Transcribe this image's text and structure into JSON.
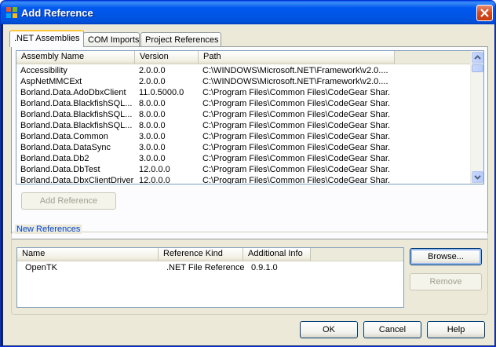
{
  "window": {
    "title": "Add Reference",
    "icons": {
      "app": "app-icon",
      "close": "close-icon"
    }
  },
  "tabs": [
    {
      "label": ".NET Assemblies",
      "active": true
    },
    {
      "label": "COM Imports",
      "active": false
    },
    {
      "label": "Project References",
      "active": false
    }
  ],
  "assemblies": {
    "columns": [
      "Assembly Name",
      "Version",
      "Path"
    ],
    "rows": [
      [
        "Accessibility",
        "2.0.0.0",
        "C:\\WINDOWS\\Microsoft.NET\\Framework\\v2.0...."
      ],
      [
        "AspNetMMCExt",
        "2.0.0.0",
        "C:\\WINDOWS\\Microsoft.NET\\Framework\\v2.0...."
      ],
      [
        "Borland.Data.AdoDbxClient",
        "11.0.5000.0",
        "C:\\Program Files\\Common Files\\CodeGear Shar..."
      ],
      [
        "Borland.Data.BlackfishSQL...",
        "8.0.0.0",
        "C:\\Program Files\\Common Files\\CodeGear Shar..."
      ],
      [
        "Borland.Data.BlackfishSQL...",
        "8.0.0.0",
        "C:\\Program Files\\Common Files\\CodeGear Shar..."
      ],
      [
        "Borland.Data.BlackfishSQL...",
        "8.0.0.0",
        "C:\\Program Files\\Common Files\\CodeGear Shar..."
      ],
      [
        "Borland.Data.Common",
        "3.0.0.0",
        "C:\\Program Files\\Common Files\\CodeGear Shar..."
      ],
      [
        "Borland.Data.DataSync",
        "3.0.0.0",
        "C:\\Program Files\\Common Files\\CodeGear Shar..."
      ],
      [
        "Borland.Data.Db2",
        "3.0.0.0",
        "C:\\Program Files\\Common Files\\CodeGear Shar..."
      ],
      [
        "Borland.Data.DbTest",
        "12.0.0.0",
        "C:\\Program Files\\Common Files\\CodeGear Shar..."
      ],
      [
        "Borland.Data.DbxClientDriver",
        "12.0.0.0",
        "C:\\Program Files\\Common Files\\CodeGear Shar..."
      ]
    ]
  },
  "add_reference_label": "Add Reference",
  "new_references": {
    "group_title": "New References",
    "columns": [
      "Name",
      "Reference Kind",
      "Additional Info"
    ],
    "rows": [
      [
        "OpenTK",
        ".NET File Reference",
        "0.9.1.0"
      ]
    ]
  },
  "buttons": {
    "browse": "Browse...",
    "remove": "Remove",
    "ok": "OK",
    "cancel": "Cancel",
    "help": "Help"
  },
  "colors": {
    "title_bar": "#0054e3",
    "dialog_bg": "#ece9d8",
    "group_title": "#0046d5",
    "close_button": "#d34a20"
  }
}
